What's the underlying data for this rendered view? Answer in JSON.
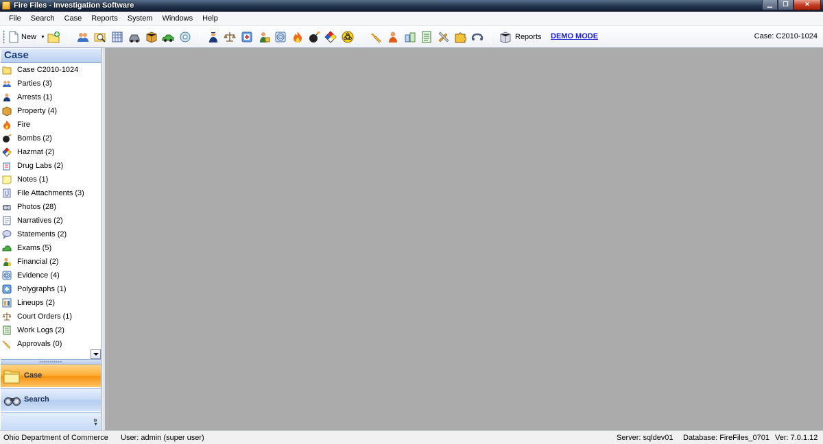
{
  "window": {
    "title": "Fire Files - Investigation Software"
  },
  "menu": [
    "File",
    "Search",
    "Case",
    "Reports",
    "System",
    "Windows",
    "Help"
  ],
  "toolbar": {
    "new_label": "New",
    "reports_label": "Reports",
    "demo_label": "DEMO MODE",
    "case_label": "Case: C2010-1024",
    "icons": [
      "add-case-icon",
      "parties-icon",
      "search-folder-icon",
      "calendar-icon",
      "vehicle-icon",
      "package-icon",
      "car-icon",
      "gear-icon",
      "arrests-icon",
      "court-orders-icon",
      "polygraph-icon",
      "financial-icon",
      "evidence-icon",
      "fire-icon",
      "bomb-icon",
      "hazmat-icon",
      "biohazard-icon",
      "approvals-icon",
      "person-icon",
      "drug-lab-icon",
      "work-logs-icon",
      "tools-icon",
      "puzzle-icon",
      "link-icon"
    ]
  },
  "sidebar": {
    "title": "Case",
    "items": [
      {
        "label": "Case C2010-1024",
        "icon": "folder-icon"
      },
      {
        "label": "Parties (3)",
        "icon": "parties-icon"
      },
      {
        "label": "Arrests (1)",
        "icon": "arrests-icon"
      },
      {
        "label": "Property (4)",
        "icon": "property-icon"
      },
      {
        "label": "Fire",
        "icon": "fire-icon"
      },
      {
        "label": "Bombs (2)",
        "icon": "bomb-icon"
      },
      {
        "label": "Hazmat (2)",
        "icon": "hazmat-icon"
      },
      {
        "label": "Drug Labs (2)",
        "icon": "drug-lab-icon"
      },
      {
        "label": "Notes (1)",
        "icon": "note-icon"
      },
      {
        "label": "File Attachments (3)",
        "icon": "attachment-icon"
      },
      {
        "label": "Photos (28)",
        "icon": "camera-icon"
      },
      {
        "label": "Narratives (2)",
        "icon": "narrative-icon"
      },
      {
        "label": "Statements (2)",
        "icon": "statement-icon"
      },
      {
        "label": "Exams (5)",
        "icon": "exam-icon"
      },
      {
        "label": "Financial (2)",
        "icon": "financial-icon"
      },
      {
        "label": "Evidence (4)",
        "icon": "evidence-icon"
      },
      {
        "label": "Polygraphs (1)",
        "icon": "polygraph-icon"
      },
      {
        "label": "Lineups (2)",
        "icon": "lineup-icon"
      },
      {
        "label": "Court Orders (1)",
        "icon": "court-icon"
      },
      {
        "label": "Work Logs (2)",
        "icon": "work-log-icon"
      },
      {
        "label": "Approvals (0)",
        "icon": "approval-icon"
      }
    ],
    "nav_buttons": [
      {
        "label": "Case",
        "icon": "folder-icon"
      },
      {
        "label": "Search",
        "icon": "binoculars-icon"
      }
    ]
  },
  "status": {
    "org": "Ohio Department of Commerce",
    "user": "User: admin (super user)",
    "server": "Server: sqldev01",
    "database": "Database: FireFiles_0701",
    "version": "Ver: 7.0.1.12"
  }
}
